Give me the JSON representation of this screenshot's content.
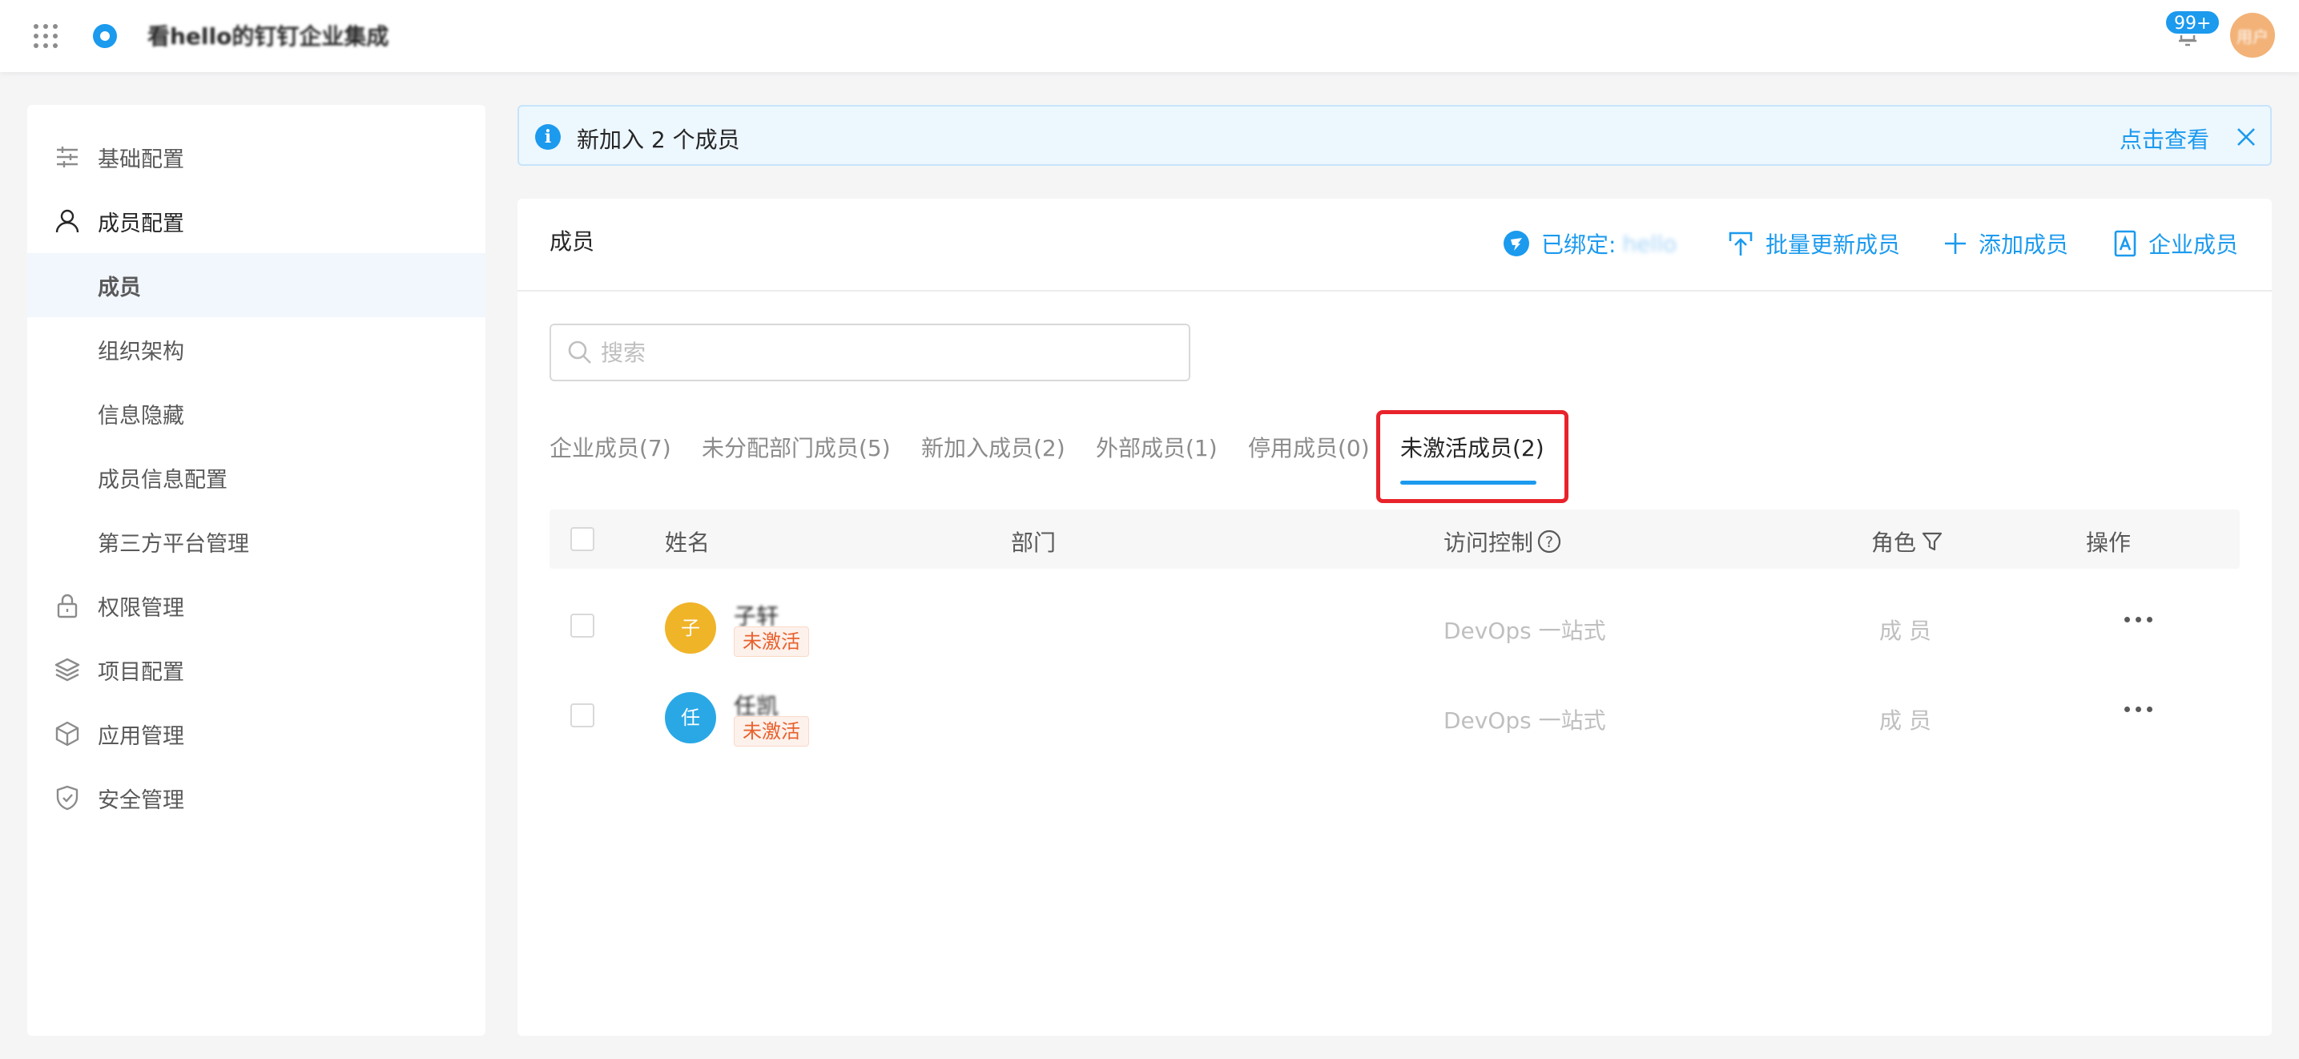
{
  "topbar": {
    "app_title": "看hello的钉钉企业集成",
    "notification_count": "99+",
    "avatar_text": "用户"
  },
  "sidebar": {
    "items": [
      {
        "label": "基础配置",
        "icon": "sliders-icon"
      },
      {
        "label": "成员配置",
        "icon": "user-icon"
      },
      {
        "label": "成员",
        "active": true
      },
      {
        "label": "组织架构"
      },
      {
        "label": "信息隐藏"
      },
      {
        "label": "成员信息配置"
      },
      {
        "label": "第三方平台管理"
      },
      {
        "label": "权限管理",
        "icon": "lock-icon"
      },
      {
        "label": "项目配置",
        "icon": "layers-icon"
      },
      {
        "label": "应用管理",
        "icon": "cube-icon"
      },
      {
        "label": "安全管理",
        "icon": "shield-icon"
      }
    ]
  },
  "alert": {
    "message": "新加入 2 个成员",
    "action": "点击查看"
  },
  "card": {
    "title": "成员",
    "bound_label": "已绑定:",
    "bound_value": "hello",
    "bulk_update": "批量更新成员",
    "add_member": "添加成员",
    "enterprise_member": "企业成员"
  },
  "search": {
    "placeholder": "搜索"
  },
  "tabs": [
    {
      "label": "企业成员(7)"
    },
    {
      "label": "未分配部门成员(5)"
    },
    {
      "label": "新加入成员(2)"
    },
    {
      "label": "外部成员(1)"
    },
    {
      "label": "停用成员(0)"
    },
    {
      "label": "未激活成员(2)",
      "active": true
    }
  ],
  "table": {
    "headers": {
      "name": "姓名",
      "department": "部门",
      "access": "访问控制",
      "role": "角色",
      "actions": "操作"
    },
    "rows": [
      {
        "avatar": "子",
        "avatar_color": "#f0b429",
        "name": "子轩",
        "status": "未激活",
        "department": "",
        "access": "DevOps 一站式",
        "role": "成 员"
      },
      {
        "avatar": "任",
        "avatar_color": "#2aa8e6",
        "name": "任凯",
        "status": "未激活",
        "department": "",
        "access": "DevOps 一站式",
        "role": "成 员"
      }
    ]
  },
  "colors": {
    "accent": "#1b9aee",
    "highlight": "#e8232b",
    "tag_text": "#e8602c"
  }
}
